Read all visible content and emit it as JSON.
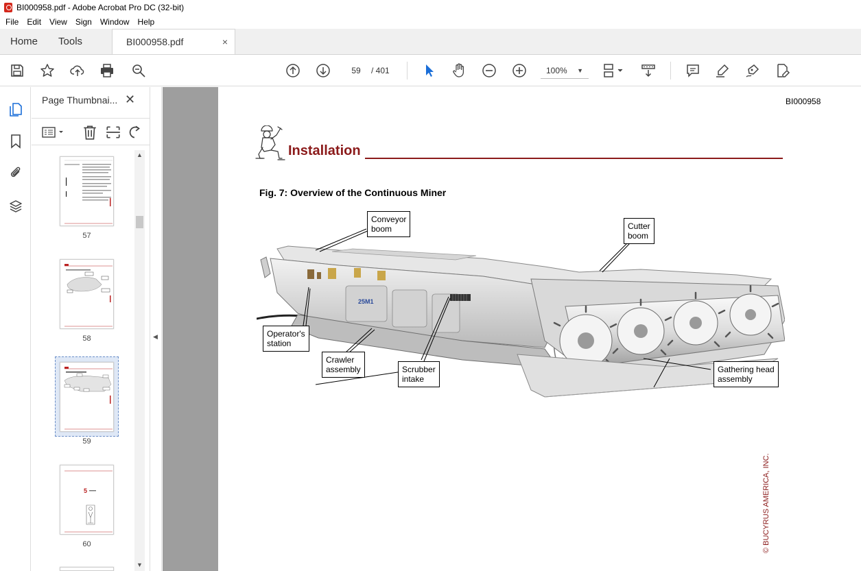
{
  "window": {
    "title": "BI000958.pdf - Adobe Acrobat Pro DC (32-bit)"
  },
  "menu": {
    "items": [
      "File",
      "Edit",
      "View",
      "Sign",
      "Window",
      "Help"
    ]
  },
  "tabs": {
    "home": "Home",
    "tools": "Tools",
    "document": "BI000958.pdf",
    "close_glyph": "×"
  },
  "toolbar": {
    "page_current": "59",
    "page_total": "/ 401",
    "zoom": "100%"
  },
  "thumbnails": {
    "panel_title": "Page Thumbnai...",
    "close_glyph": "✕",
    "pages": [
      {
        "label": "57"
      },
      {
        "label": "58"
      },
      {
        "label": "59"
      },
      {
        "label": "60"
      }
    ],
    "thumb60_number": "5"
  },
  "page": {
    "doc_id": "BI000958",
    "section_title": "Installation",
    "figure_caption": "Fig. 7: Overview of the Continuous Miner",
    "copyright": "© BUCYRUS AMERICA, INC.",
    "machine_badge": "25M1",
    "callouts": {
      "conveyor": "Conveyor\nboom",
      "cutter": "Cutter\nboom",
      "operator": "Operator's\nstation",
      "crawler": "Crawler\nassembly",
      "scrubber": "Scrubber\nintake",
      "gathering": "Gathering head\nassembly"
    }
  },
  "colors": {
    "accent_red": "#8b1a1a",
    "selection_blue": "#6a8ec8",
    "doc_bg": "#9e9e9e"
  }
}
